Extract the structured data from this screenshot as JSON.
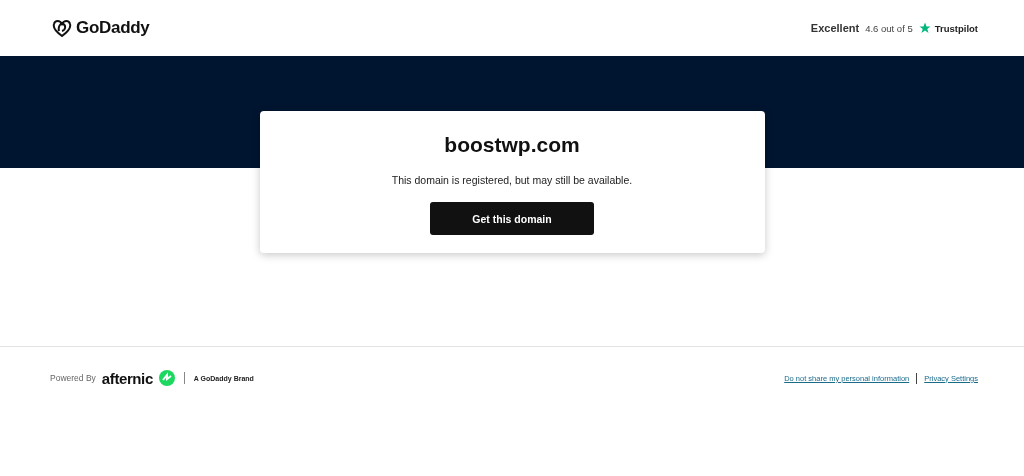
{
  "header": {
    "logo": "GoDaddy",
    "rating": {
      "label": "Excellent",
      "score": "4.6 out of 5",
      "brand": "Trustpilot"
    }
  },
  "card": {
    "domain": "boostwp.com",
    "message": "This domain is registered, but may still be available.",
    "button": "Get this domain"
  },
  "footer": {
    "powered_by": "Powered By",
    "brand": "afternic",
    "tagline": "A GoDaddy Brand",
    "links": [
      "Do not share my personal information",
      "Privacy Settings"
    ]
  }
}
